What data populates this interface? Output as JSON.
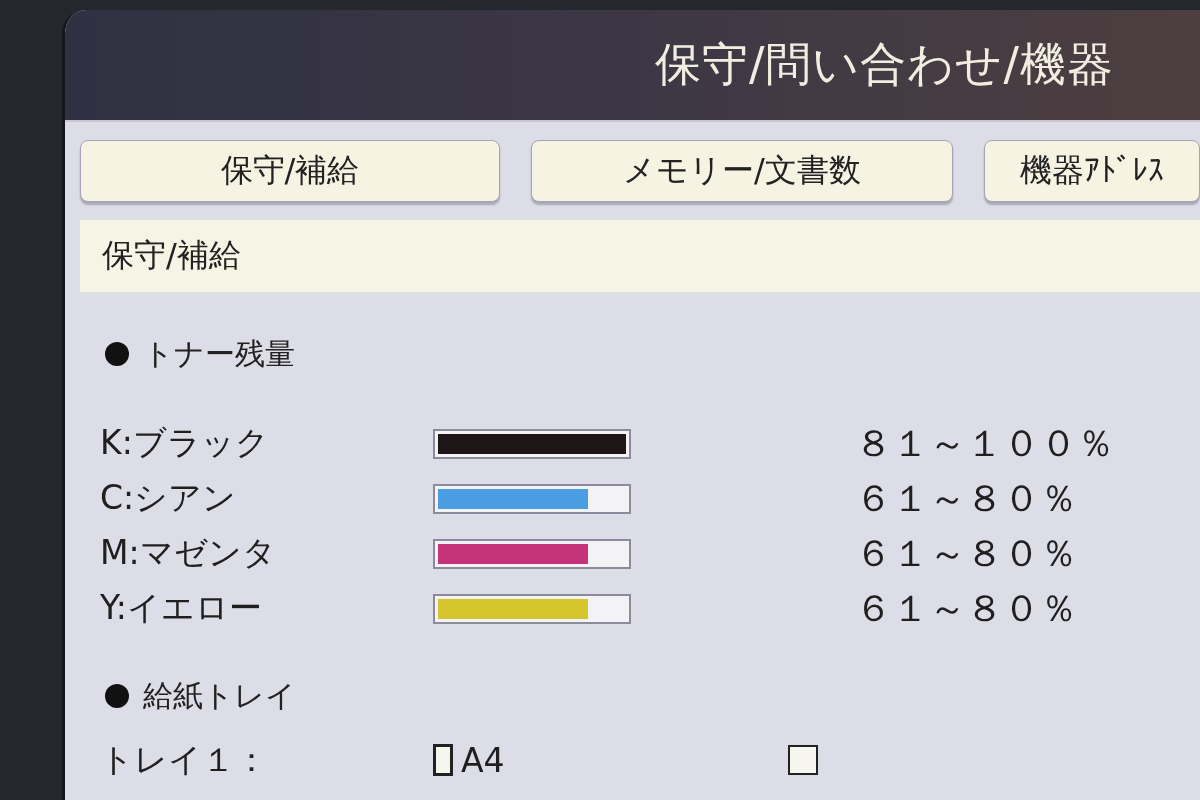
{
  "screen": {
    "title": "保守/問い合わせ/機器"
  },
  "tabs": [
    {
      "label": "保守/補給"
    },
    {
      "label": "メモリー/文書数"
    },
    {
      "label": "機器ｱﾄﾞﾚｽ"
    }
  ],
  "section": {
    "title": "保守/補給"
  },
  "toner": {
    "heading": "トナー残量",
    "items": [
      {
        "label": "K:ブラック",
        "level": 1,
        "color": "#1e1517",
        "reading": "８１～１００％"
      },
      {
        "label": "C:シアン",
        "level": 0.8,
        "color": "#4a9de0",
        "reading": "６１～８０％"
      },
      {
        "label": "M:マゼンタ",
        "level": 0.8,
        "color": "#c53479",
        "reading": "６１～８０％"
      },
      {
        "label": "Y:イエロー",
        "level": 0.8,
        "color": "#d6c62e",
        "reading": "６１～８０％"
      }
    ]
  },
  "paper_trays": {
    "heading": "給紙トレイ",
    "items": [
      {
        "label": "トレイ１：",
        "size": "A4"
      }
    ]
  }
}
